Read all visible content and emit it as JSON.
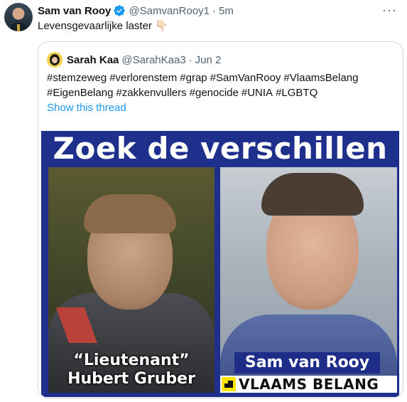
{
  "tweet": {
    "author_name": "Sam van Rooy",
    "handle": "@SamvanRooy1",
    "separator": "·",
    "time": "5m",
    "text": "Levensgevaarlijke laster 👇🏻",
    "more_label": "···"
  },
  "quote": {
    "author_name": "Sarah Kaa",
    "handle": "@SarahKaa3",
    "separator": "·",
    "time": "Jun 2",
    "hashtags": [
      "#stemzeweg",
      "#verlorenstem",
      "#grap",
      "#SamVanRooy",
      "#VlaamsBelang",
      "#EigenBelang",
      "#zakkenvullers",
      "#genocide",
      "#UNIA",
      "#LGBTQ"
    ],
    "show_thread": "Show this thread",
    "image": {
      "title": "Zoek de verschillen",
      "left_caption_line1": "“Lieutenant”",
      "left_caption_line2": "Hubert Gruber",
      "right_caption": "Sam van Rooy",
      "party_name": "VLAAMS BELANG"
    }
  },
  "colors": {
    "link": "#1d9bf0",
    "verified": "#1d9bf0",
    "meme_background": "#1f2f8c",
    "secondary_text": "#536471"
  }
}
